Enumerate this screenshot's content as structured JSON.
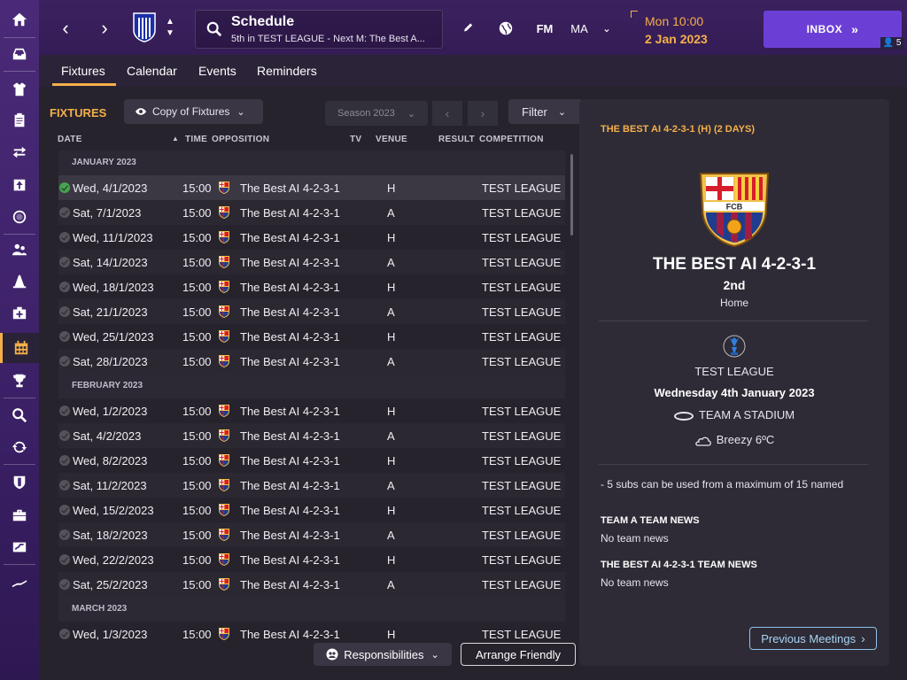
{
  "header": {
    "title": "Schedule",
    "subtitle": "5th in TEST LEAGUE - Next M: The Best A...",
    "fm_label": "FM",
    "profile_initials": "MA",
    "time": "Mon 10:00",
    "date": "2 Jan 2023",
    "inbox_label": "INBOX",
    "inbox_count": "5"
  },
  "tabs": [
    {
      "label": "Fixtures",
      "active": true
    },
    {
      "label": "Calendar"
    },
    {
      "label": "Events"
    },
    {
      "label": "Reminders"
    }
  ],
  "toolbar": {
    "section_title": "FIXTURES",
    "copy_label": "Copy of Fixtures",
    "season_label": "Season 2023",
    "filter_label": "Filter"
  },
  "columns": {
    "date": "DATE",
    "time": "TIME",
    "opposition": "OPPOSITION",
    "tv": "TV",
    "venue": "VENUE",
    "result": "RESULT",
    "competition": "COMPETITION"
  },
  "months": [
    "JANUARY 2023",
    "FEBRUARY 2023",
    "MARCH 2023"
  ],
  "fixtures": [
    {
      "date": "Wed, 4/1/2023",
      "time": "15:00",
      "opp": "The Best AI 4-2-3-1",
      "venue": "H",
      "comp": "TEST LEAGUE"
    },
    {
      "date": "Sat, 7/1/2023",
      "time": "15:00",
      "opp": "The Best AI 4-2-3-1",
      "venue": "A",
      "comp": "TEST LEAGUE"
    },
    {
      "date": "Wed, 11/1/2023",
      "time": "15:00",
      "opp": "The Best AI 4-2-3-1",
      "venue": "H",
      "comp": "TEST LEAGUE"
    },
    {
      "date": "Sat, 14/1/2023",
      "time": "15:00",
      "opp": "The Best AI 4-2-3-1",
      "venue": "A",
      "comp": "TEST LEAGUE"
    },
    {
      "date": "Wed, 18/1/2023",
      "time": "15:00",
      "opp": "The Best AI 4-2-3-1",
      "venue": "H",
      "comp": "TEST LEAGUE"
    },
    {
      "date": "Sat, 21/1/2023",
      "time": "15:00",
      "opp": "The Best AI 4-2-3-1",
      "venue": "A",
      "comp": "TEST LEAGUE"
    },
    {
      "date": "Wed, 25/1/2023",
      "time": "15:00",
      "opp": "The Best AI 4-2-3-1",
      "venue": "H",
      "comp": "TEST LEAGUE"
    },
    {
      "date": "Sat, 28/1/2023",
      "time": "15:00",
      "opp": "The Best AI 4-2-3-1",
      "venue": "A",
      "comp": "TEST LEAGUE"
    },
    {
      "date": "Wed, 1/2/2023",
      "time": "15:00",
      "opp": "The Best AI 4-2-3-1",
      "venue": "H",
      "comp": "TEST LEAGUE"
    },
    {
      "date": "Sat, 4/2/2023",
      "time": "15:00",
      "opp": "The Best AI 4-2-3-1",
      "venue": "A",
      "comp": "TEST LEAGUE"
    },
    {
      "date": "Wed, 8/2/2023",
      "time": "15:00",
      "opp": "The Best AI 4-2-3-1",
      "venue": "H",
      "comp": "TEST LEAGUE"
    },
    {
      "date": "Sat, 11/2/2023",
      "time": "15:00",
      "opp": "The Best AI 4-2-3-1",
      "venue": "A",
      "comp": "TEST LEAGUE"
    },
    {
      "date": "Wed, 15/2/2023",
      "time": "15:00",
      "opp": "The Best AI 4-2-3-1",
      "venue": "H",
      "comp": "TEST LEAGUE"
    },
    {
      "date": "Sat, 18/2/2023",
      "time": "15:00",
      "opp": "The Best AI 4-2-3-1",
      "venue": "A",
      "comp": "TEST LEAGUE"
    },
    {
      "date": "Wed, 22/2/2023",
      "time": "15:00",
      "opp": "The Best AI 4-2-3-1",
      "venue": "H",
      "comp": "TEST LEAGUE"
    },
    {
      "date": "Sat, 25/2/2023",
      "time": "15:00",
      "opp": "The Best AI 4-2-3-1",
      "venue": "A",
      "comp": "TEST LEAGUE"
    },
    {
      "date": "Wed, 1/3/2023",
      "time": "15:00",
      "opp": "The Best AI 4-2-3-1",
      "venue": "H",
      "comp": "TEST LEAGUE"
    }
  ],
  "bottom": {
    "responsibilities_label": "Responsibilities",
    "arrange_label": "Arrange Friendly"
  },
  "detail": {
    "title": "THE BEST AI 4-2-3-1 (H) (2 DAYS)",
    "crest_text": "FCB",
    "team": "THE BEST AI 4-2-3-1",
    "position": "2nd",
    "venue": "Home",
    "competition": "TEST LEAGUE",
    "match_date": "Wednesday 4th January 2023",
    "stadium": "TEAM A STADIUM",
    "weather": "Breezy 6ºC",
    "rule": "- 5 subs can be used from a maximum of 15 named",
    "news1_head": "TEAM A TEAM NEWS",
    "news1_text": "No team news",
    "news2_head": "THE BEST AI 4-2-3-1 TEAM NEWS",
    "news2_text": "No team news",
    "prev_label": "Previous Meetings"
  },
  "colors": {
    "accent": "#f5b04a",
    "inbox": "#6b3fd6",
    "sidebar": "#4a2a78",
    "panel": "#26232d",
    "link": "#8fc2ea"
  },
  "sidebar_icons": [
    "home-icon",
    "inbox-icon",
    "squad-icon",
    "tactics-icon",
    "transfers-icon",
    "reports-icon",
    "scouting-icon",
    "staff-icon",
    "training-icon",
    "medical-icon",
    "schedule-icon",
    "competitions-icon",
    "search-icon",
    "refresh-icon",
    "club-icon",
    "finances-icon",
    "dev-centre-icon",
    "analytics-icon"
  ]
}
